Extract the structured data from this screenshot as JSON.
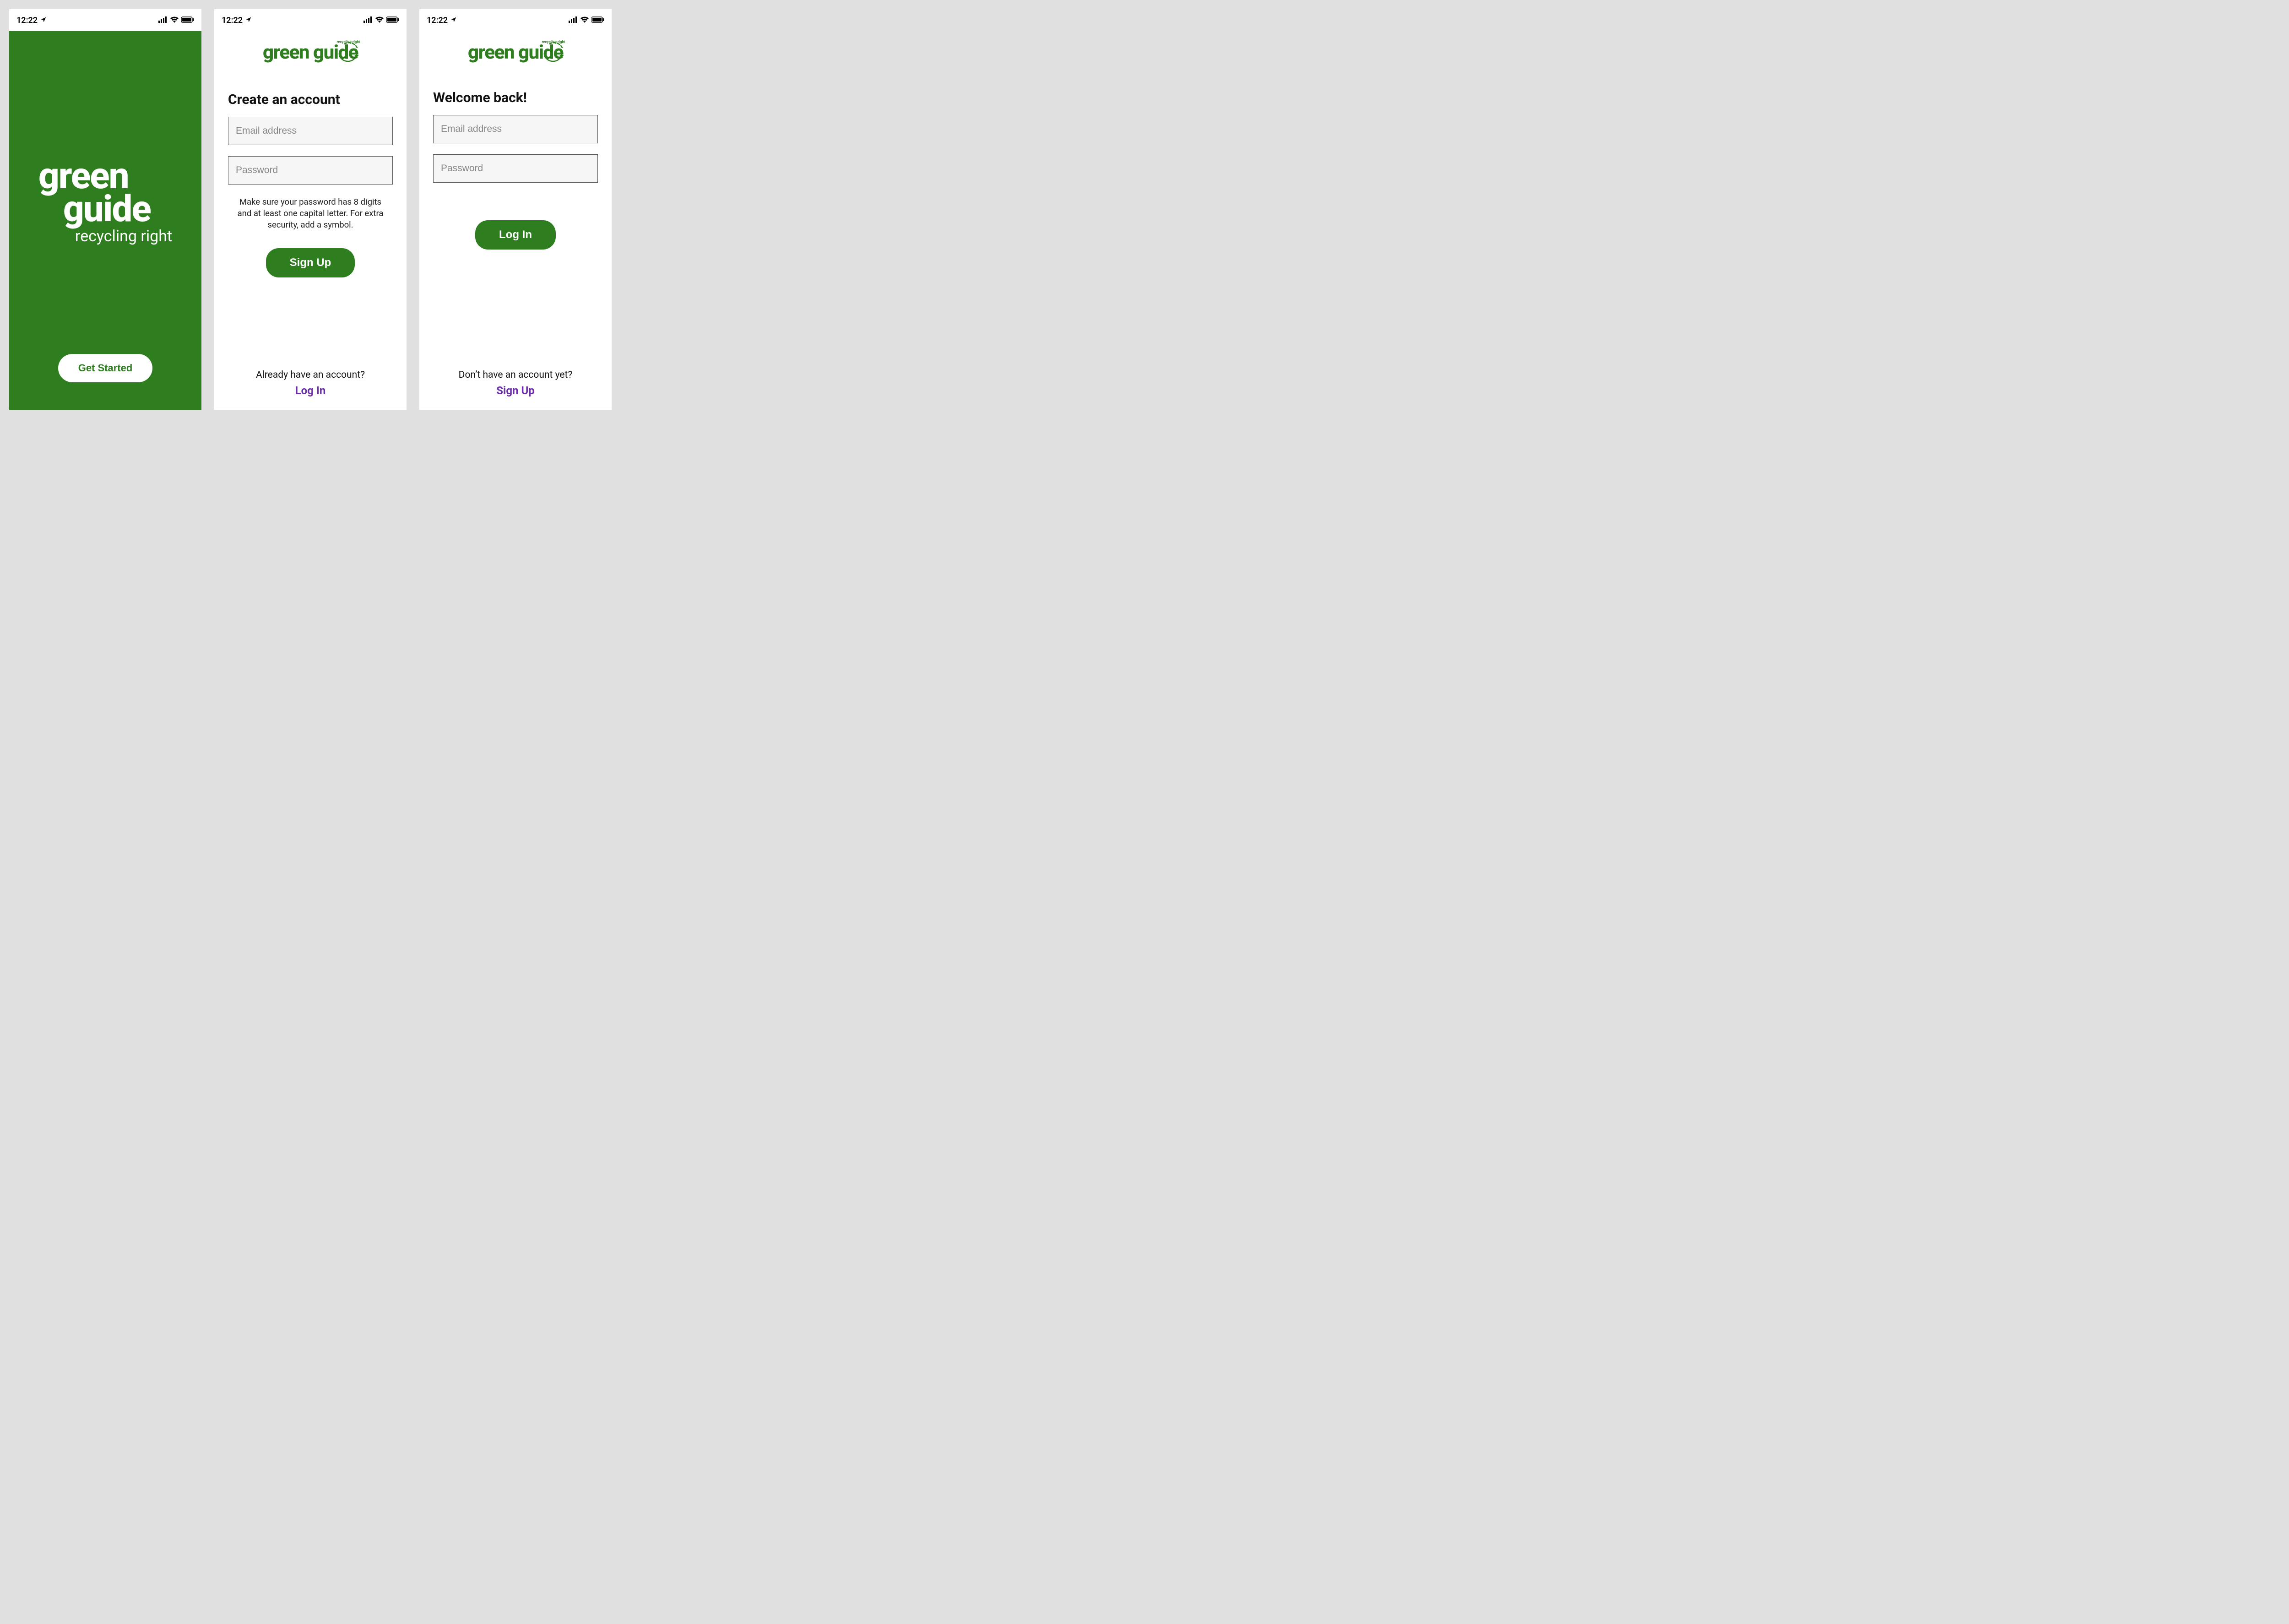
{
  "colors": {
    "brand_green": "#2e7d1f",
    "link_purple": "#6b2fa6",
    "input_bg": "#f6f6f6"
  },
  "status": {
    "time": "12:22"
  },
  "brand": {
    "word1": "green",
    "word2": "guide",
    "full": "green guide",
    "tagline": "recycling right"
  },
  "splash": {
    "cta": "Get Started"
  },
  "signup": {
    "heading": "Create an account",
    "email_placeholder": "Email address",
    "password_placeholder": "Password",
    "hint": "Make sure your password has 8 digits and at least one capital letter. For extra security, add a symbol.",
    "submit": "Sign Up",
    "alt_prompt": "Already have an account?",
    "alt_link": "Log In"
  },
  "login": {
    "heading": "Welcome back!",
    "email_placeholder": "Email address",
    "password_placeholder": "Password",
    "submit": "Log In",
    "alt_prompt": "Don’t have an account yet?",
    "alt_link": "Sign Up"
  }
}
